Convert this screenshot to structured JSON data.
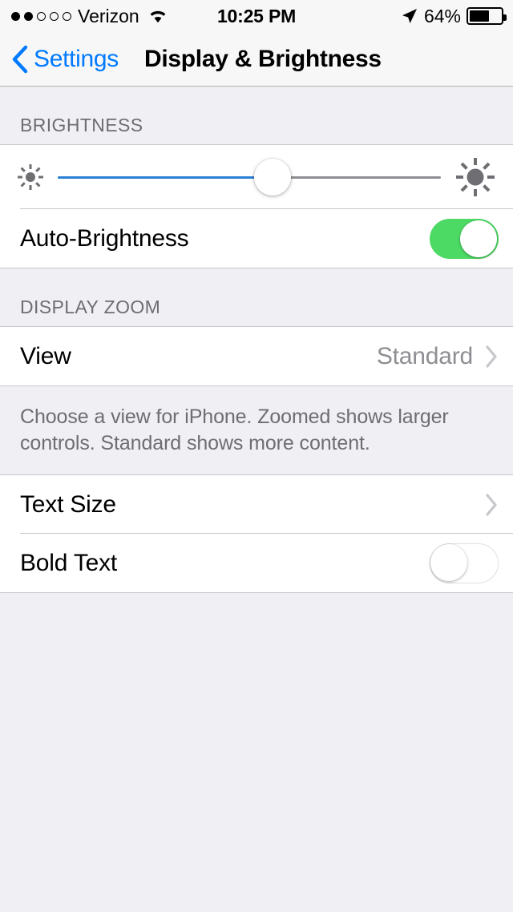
{
  "status_bar": {
    "signal_dots_filled": 2,
    "signal_dots_total": 5,
    "carrier": "Verizon",
    "wifi_icon": "wifi-icon",
    "time": "10:25 PM",
    "location_icon": "location-arrow-icon",
    "battery_percent": "64%",
    "battery_level": 64
  },
  "nav": {
    "back_label": "Settings",
    "back_icon": "chevron-left-icon",
    "title": "Display & Brightness"
  },
  "brightness": {
    "header": "BRIGHTNESS",
    "slider": {
      "min_icon": "sun-small-icon",
      "max_icon": "sun-large-icon",
      "value_percent": 56
    },
    "auto_brightness": {
      "label": "Auto-Brightness",
      "state": "on",
      "on_color": "#4CD964"
    }
  },
  "display_zoom": {
    "header": "DISPLAY ZOOM",
    "view_row": {
      "label": "View",
      "value": "Standard",
      "chevron": "chevron-right-icon"
    },
    "footer_note": "Choose a view for iPhone. Zoomed shows larger controls. Standard shows more content."
  },
  "text_settings": {
    "text_size_row": {
      "label": "Text Size",
      "chevron": "chevron-right-icon"
    },
    "bold_text_row": {
      "label": "Bold Text",
      "state": "off"
    }
  },
  "colors": {
    "accent_blue": "#007AFF",
    "slider_blue": "#2A7FD4",
    "background_gray": "#EFEFF4",
    "separator": "#C8C7CC",
    "secondary_text": "#8E8E93",
    "header_text": "#6D6D72"
  }
}
